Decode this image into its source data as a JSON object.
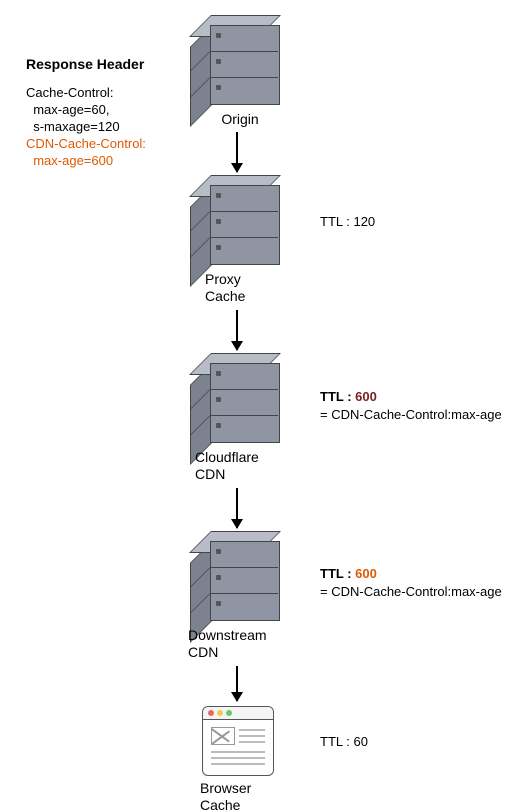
{
  "header": {
    "title": "Response Header",
    "line1": "Cache-Control:",
    "line2": "  max-age=60,",
    "line3": "  s-maxage=120",
    "line4": "CDN-Cache-Control:",
    "line5": "  max-age=600"
  },
  "nodes": {
    "origin": "Origin",
    "proxy_l1": "Proxy",
    "proxy_l2": "Cache",
    "cf_l1": "Cloudflare",
    "cf_l2": "CDN",
    "ds_l1": "Downstream",
    "ds_l2": "CDN",
    "browser_l1": "Browser",
    "browser_l2": "Cache"
  },
  "ttl": {
    "proxy_prefix": "TTL : ",
    "proxy_val": "120",
    "cf_prefix": "TTL : ",
    "cf_val": "600",
    "cf_sub": "= CDN-Cache-Control:max-age",
    "ds_prefix": "TTL : ",
    "ds_val": "600",
    "ds_sub": "= CDN-Cache-Control:max-age",
    "browser_prefix": "TTL : ",
    "browser_val": "60"
  },
  "colors": {
    "accent": "#e05a00"
  }
}
